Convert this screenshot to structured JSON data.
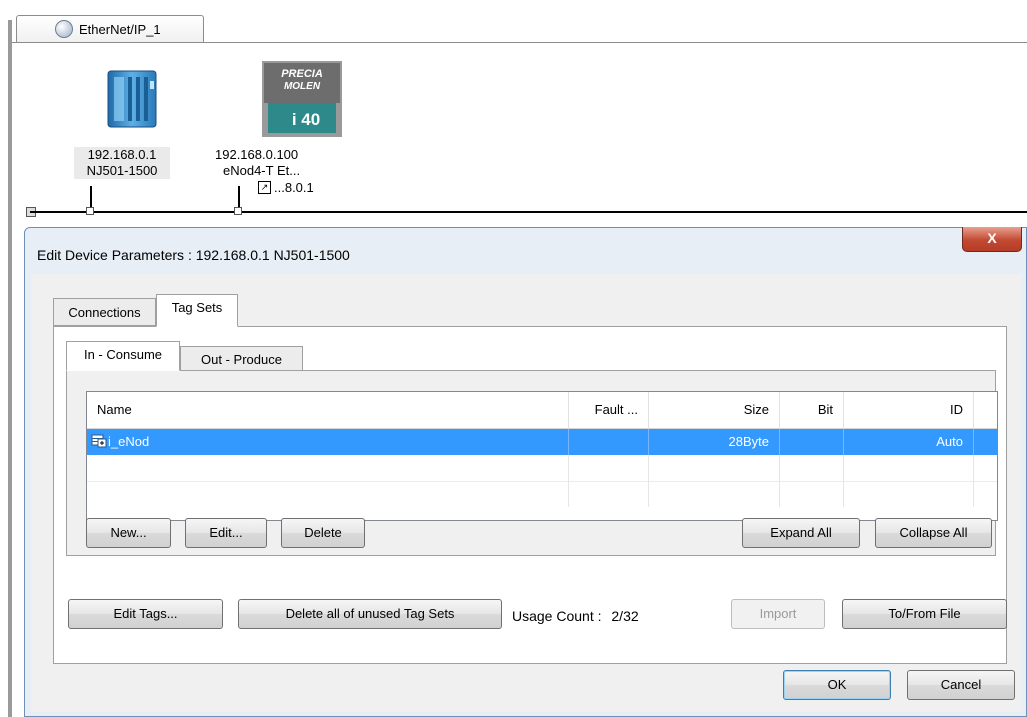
{
  "network": {
    "tab_label": "EtherNet/IP_1",
    "devices": [
      {
        "ip": "192.168.0.1",
        "name": "NJ501-1500"
      },
      {
        "ip": "192.168.0.100",
        "name": "eNod4-T Et...",
        "sub_label": "...8.0.1",
        "logo_text_top": "PRECIA",
        "logo_text_mid": "MOLEN",
        "logo_text_bottom": "i 40"
      }
    ]
  },
  "dialog": {
    "title": "Edit Device Parameters : 192.168.0.1 NJ501-1500",
    "close_label": "X",
    "tabs": [
      "Connections",
      "Tag Sets"
    ],
    "subtabs": [
      "In - Consume",
      "Out - Produce"
    ],
    "table": {
      "columns": [
        "Name",
        "Fault ...",
        "Size",
        "Bit",
        "ID"
      ],
      "rows": [
        {
          "name": "i_eNod",
          "fault": "",
          "size": "28Byte",
          "bit": "",
          "id": "Auto"
        }
      ]
    },
    "inner_buttons": {
      "new": "New...",
      "edit": "Edit...",
      "delete": "Delete",
      "expand_all": "Expand All",
      "collapse_all": "Collapse All"
    },
    "outer_buttons": {
      "edit_tags": "Edit Tags...",
      "delete_unused": "Delete all of unused Tag Sets",
      "import": "Import",
      "to_from_file": "To/From File"
    },
    "usage_label": "Usage Count :",
    "usage_value": "2/32",
    "footer": {
      "ok": "OK",
      "cancel": "Cancel"
    }
  },
  "colors": {
    "selection": "#3399ff",
    "dialog_frame": "#e8eef6",
    "close_button": "#c24a33"
  }
}
